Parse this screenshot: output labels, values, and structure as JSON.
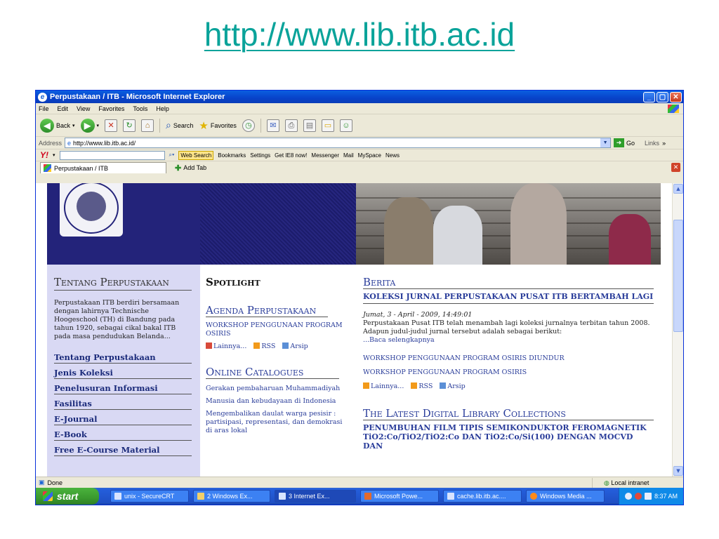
{
  "slide": {
    "url_title": "http://www.lib.itb.ac.id"
  },
  "window": {
    "title": "Perpustakaan / ITB - Microsoft Internet Explorer",
    "menu": [
      "File",
      "Edit",
      "View",
      "Favorites",
      "Tools",
      "Help"
    ],
    "toolbar": {
      "back": "Back",
      "search": "Search",
      "favorites": "Favorites"
    },
    "address": {
      "label": "Address",
      "url": "http://www.lib.itb.ac.id/",
      "go": "Go",
      "links": "Links"
    },
    "yahoo": {
      "logo": "Y!",
      "web_search": "Web Search",
      "bookmarks": "Bookmarks",
      "settings": "Settings",
      "ie8": "Get IE8 now!",
      "messenger": "Messenger",
      "mail": "Mail",
      "myspace": "MySpace",
      "news": "News"
    },
    "tab": {
      "label": "Perpustakaan / ITB",
      "add": "Add Tab"
    }
  },
  "page": {
    "left": {
      "heading": "Tentang Perpustakaan",
      "intro": "Perpustakaan ITB berdiri bersamaan dengan lahirnya Technische Hoogeschool (TH) di Bandung pada tahun 1920, sebagai cikal bakal ITB pada masa pendudukan Belanda...",
      "nav": [
        "Tentang Perpustakaan",
        "Jenis Koleksi",
        "Penelusuran Informasi",
        "Fasilitas",
        "E-Journal",
        "E-Book",
        "Free E-Course Material"
      ]
    },
    "mid": {
      "spotlight": "Spotlight",
      "agenda_heading": "Agenda Perpustakaan",
      "agenda_item": "WORKSHOP PENGGUNAAN PROGRAM OSIRIS",
      "feeds": [
        "Lainnya...",
        "RSS",
        "Arsip"
      ],
      "catalogue_heading": "Online Catalogues",
      "catalogues": [
        "Gerakan pembaharuan Muhammadiyah",
        "Manusia dan kebudayaan di Indonesia",
        "Mengembalikan daulat warga pesisir : partisipasi, representasi, dan demokrasi di aras lokal"
      ]
    },
    "right": {
      "berita_heading": "Berita",
      "news_title": "KOLEKSI JURNAL PERPUSTAKAAN PUSAT ITB BERTAMBAH LAGI",
      "news_date": "Jumat, 3 - April - 2009, 14:49:01",
      "news_body": "Perpustakaan Pusat ITB telah menambah lagi koleksi jurnalnya terbitan tahun 2008. Adapun judul-judul jurnal tersebut adalah sebagai berikut:",
      "read_more": "...Baca selengkapnya",
      "news_links": [
        "WORKSHOP PENGGUNAAN PROGRAM OSIRIS DIUNDUR",
        "WORKSHOP PENGGUNAAN PROGRAM OSIRIS"
      ],
      "feeds": [
        "Lainnya...",
        "RSS",
        "Arsip"
      ],
      "collections_heading": "The Latest Digital Library Collections",
      "collection_title": "PENUMBUHAN FILM TIPIS SEMIKONDUKTOR FEROMAGNETIK TiO2:Co/TiO2/TiO2:Co DAN TiO2:Co/Si(100) DENGAN MOCVD DAN"
    }
  },
  "status": {
    "left": "Done",
    "zone": "Local intranet"
  },
  "taskbar": {
    "start": "start",
    "tasks": [
      "unix - SecureCRT",
      "2 Windows Ex...",
      "3 Internet Ex...",
      "Microsoft Powe...",
      "cache.lib.itb.ac....",
      "Windows Media ..."
    ],
    "clock": "8:37 AM"
  }
}
